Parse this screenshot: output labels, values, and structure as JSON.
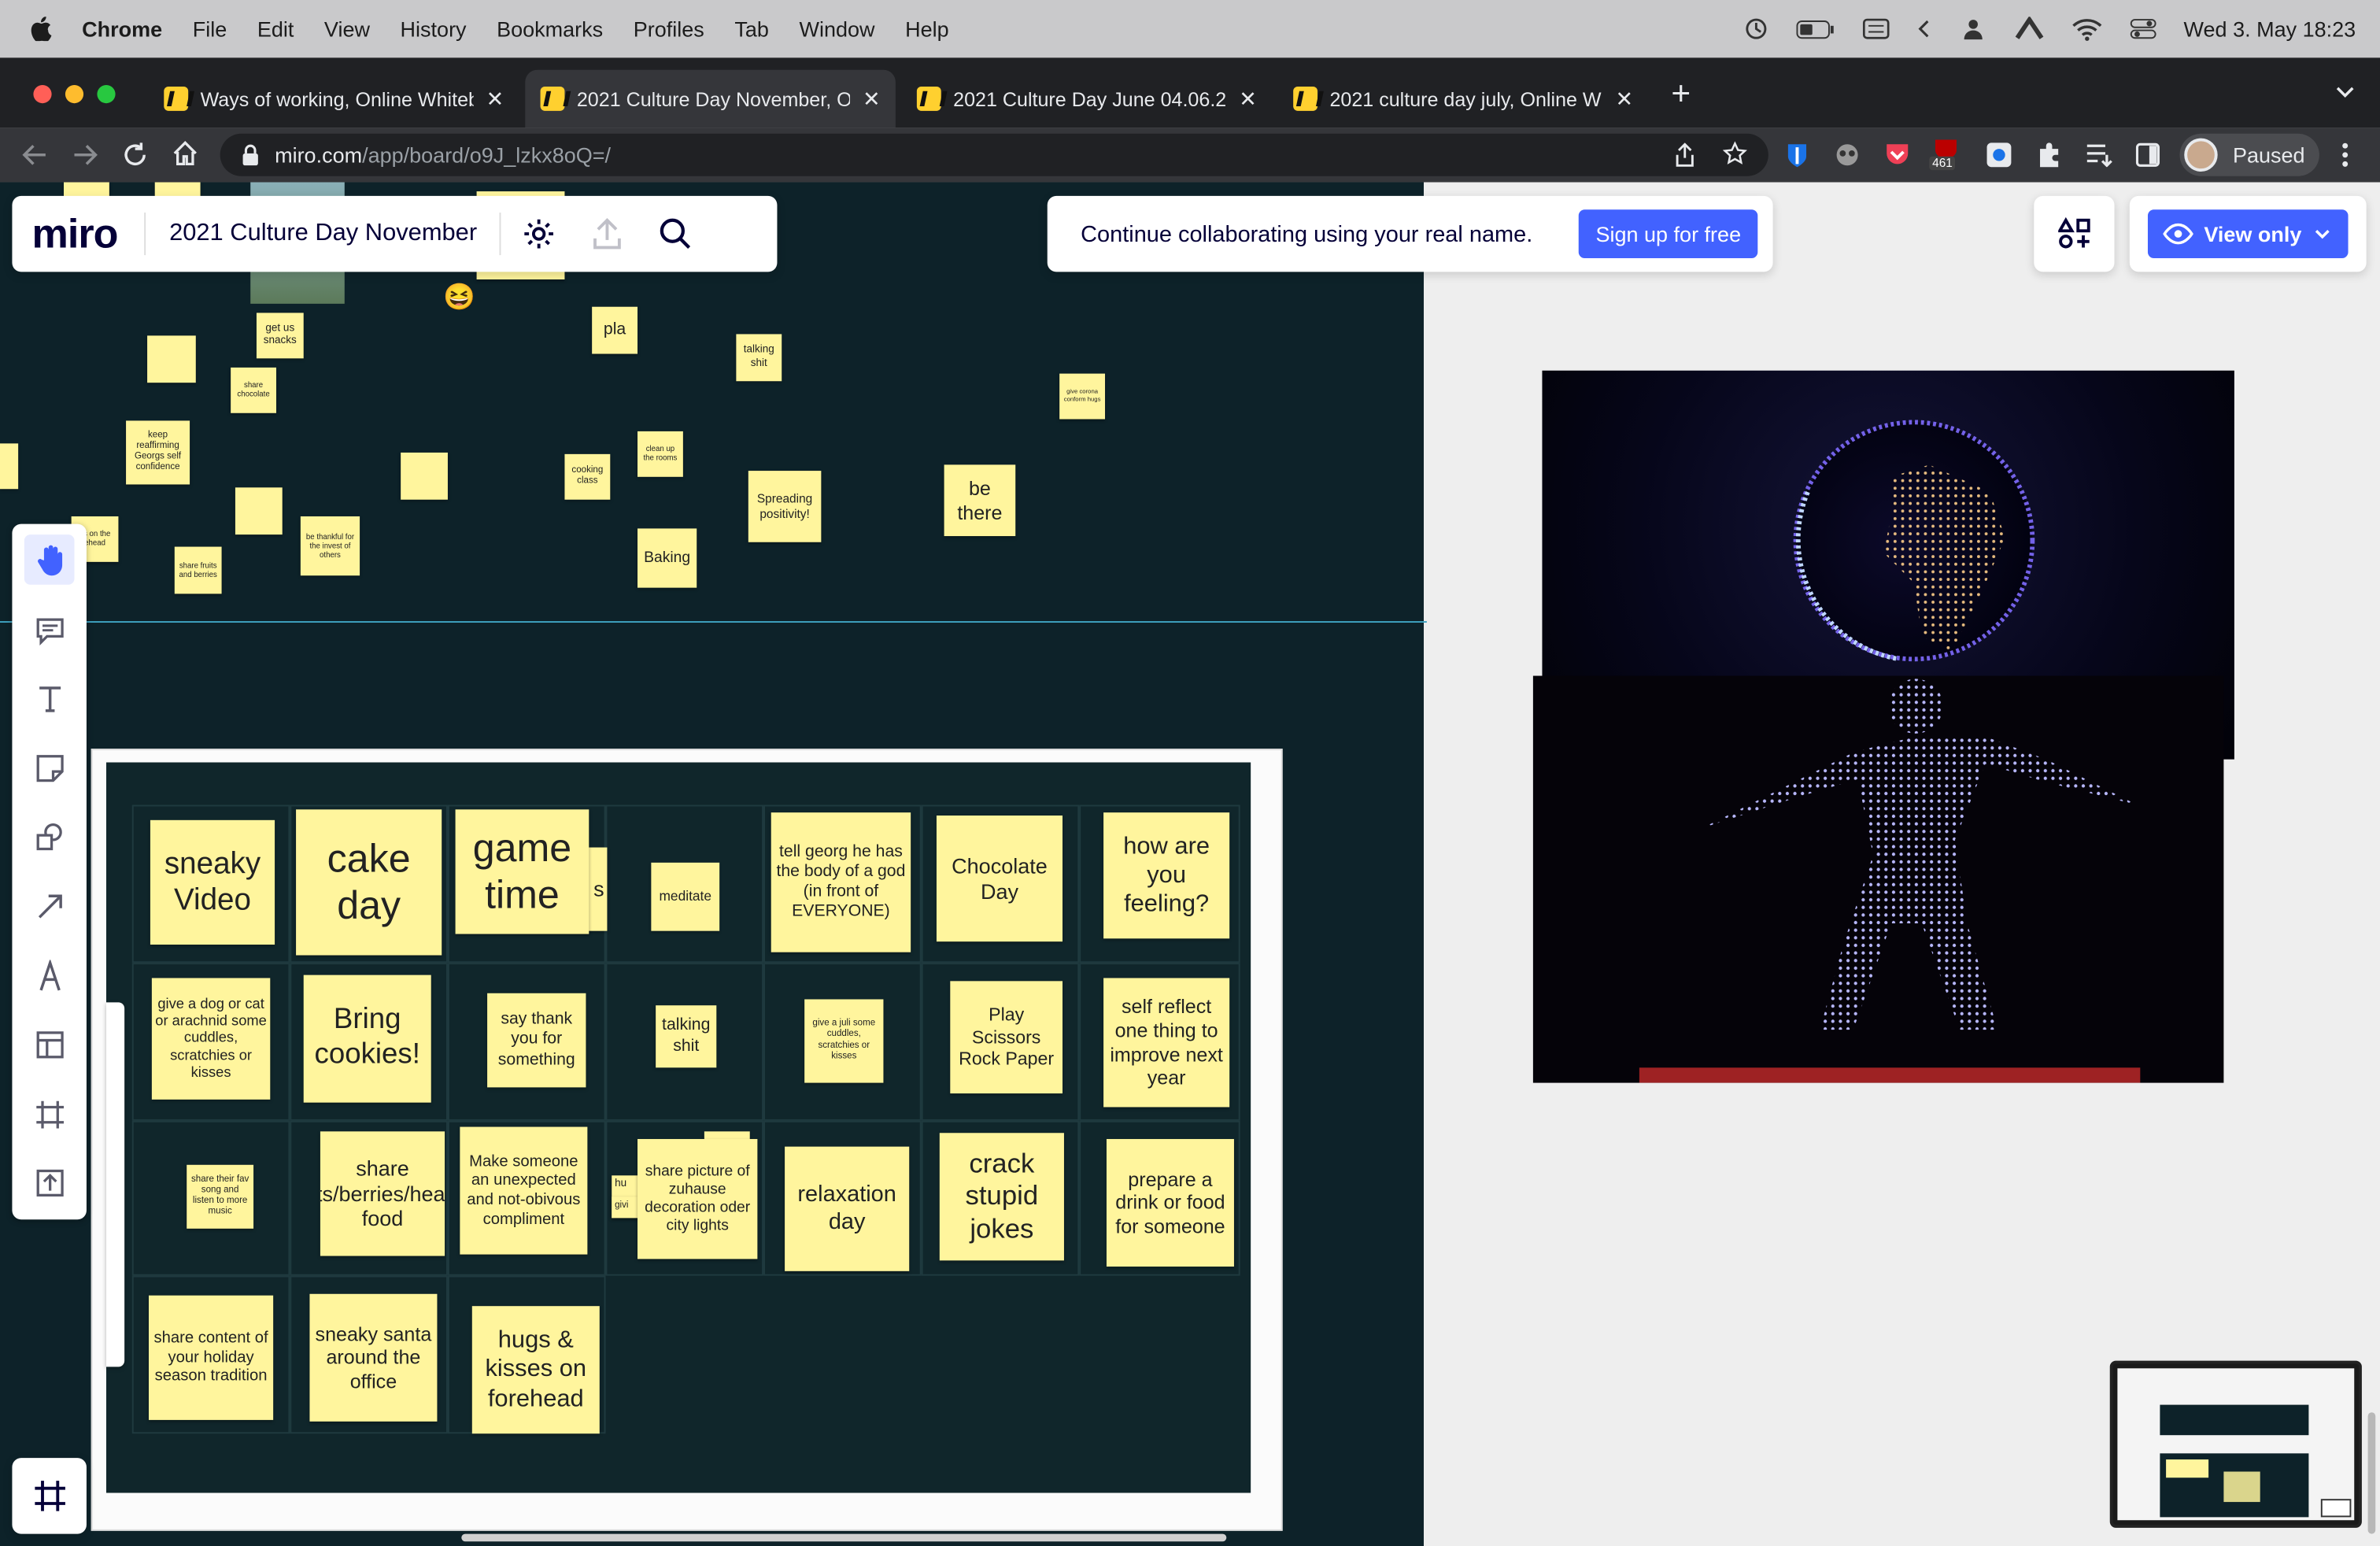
{
  "menubar": {
    "app": "Chrome",
    "items": [
      "File",
      "Edit",
      "View",
      "History",
      "Bookmarks",
      "Profiles",
      "Tab",
      "Window",
      "Help"
    ],
    "datetime": "Wed 3. May  18:23"
  },
  "tabs": [
    {
      "title": "Ways of working, Online Whiteb"
    },
    {
      "title": "2021 Culture Day November, O"
    },
    {
      "title": "2021 Culture Day June 04.06.2"
    },
    {
      "title": "2021 culture day july, Online W"
    }
  ],
  "address": {
    "domain": "miro.com",
    "path": "/app/board/o9J_lzkx8oQ=/"
  },
  "ext_badge": "461",
  "profile_label": "Paused",
  "board": {
    "logo": "miro",
    "title": "2021 Culture Day November"
  },
  "banner": {
    "text": "Continue collaborating using your real name.",
    "button": "Sign up for free"
  },
  "view_only": "View only",
  "top_notes": [
    {
      "text": "get us snacks"
    },
    {
      "text": "share chocolate"
    },
    {
      "text": "pla"
    },
    {
      "text": "talking shit"
    },
    {
      "text": "give corona conform hugs"
    },
    {
      "text": "keep reaffirming Georgs self confidence"
    },
    {
      "text": "clean up the rooms"
    },
    {
      "text": "cooking class"
    },
    {
      "text": "Spreading positivity!"
    },
    {
      "text": "be there"
    },
    {
      "text": "es on the ehead"
    },
    {
      "text": "share fruits and berries"
    },
    {
      "text": "be thankful for the invest of others"
    },
    {
      "text": "Baking"
    }
  ],
  "emoji": "😆",
  "bingo": [
    {
      "text": "sneaky Video"
    },
    {
      "text": "cake day"
    },
    {
      "text": "game time"
    },
    {
      "text": "meditate"
    },
    {
      "text": "tell georg he has the body of a god (in front of EVERYONE)"
    },
    {
      "text": "Chocolate Day"
    },
    {
      "text": "how are you feeling?"
    },
    {
      "text": "give a dog or cat or arachnid some cuddles, scratchies or kisses"
    },
    {
      "text": "Bring cookies!"
    },
    {
      "text": "say thank you for something"
    },
    {
      "text": "talking shit"
    },
    {
      "text": "give a juli some cuddles, scratchies or kisses"
    },
    {
      "text": "Play Scissors Rock Paper"
    },
    {
      "text": "self reflect one thing to improve next year"
    },
    {
      "text": "share their fav song and listen to more music"
    },
    {
      "text": "share fruits/berries/healthy food"
    },
    {
      "text": "Make someone an unexpected and not-obivous compliment"
    },
    {
      "text": "share picture of zuhause decoration oder city lights"
    },
    {
      "text": "relaxation day"
    },
    {
      "text": "crack stupid jokes"
    },
    {
      "text": "prepare a drink or food for someone"
    },
    {
      "text": "share content of your holiday season tradition"
    },
    {
      "text": "sneaky santa around the office"
    },
    {
      "text": "hugs & kisses on forehead"
    }
  ],
  "partial_notes": {
    "a": "s",
    "b": "hu",
    "c": "givi"
  },
  "colors": {
    "miro_blue": "#4262ff",
    "sticky": "#fff59d",
    "board_dark": "#0d2229"
  }
}
